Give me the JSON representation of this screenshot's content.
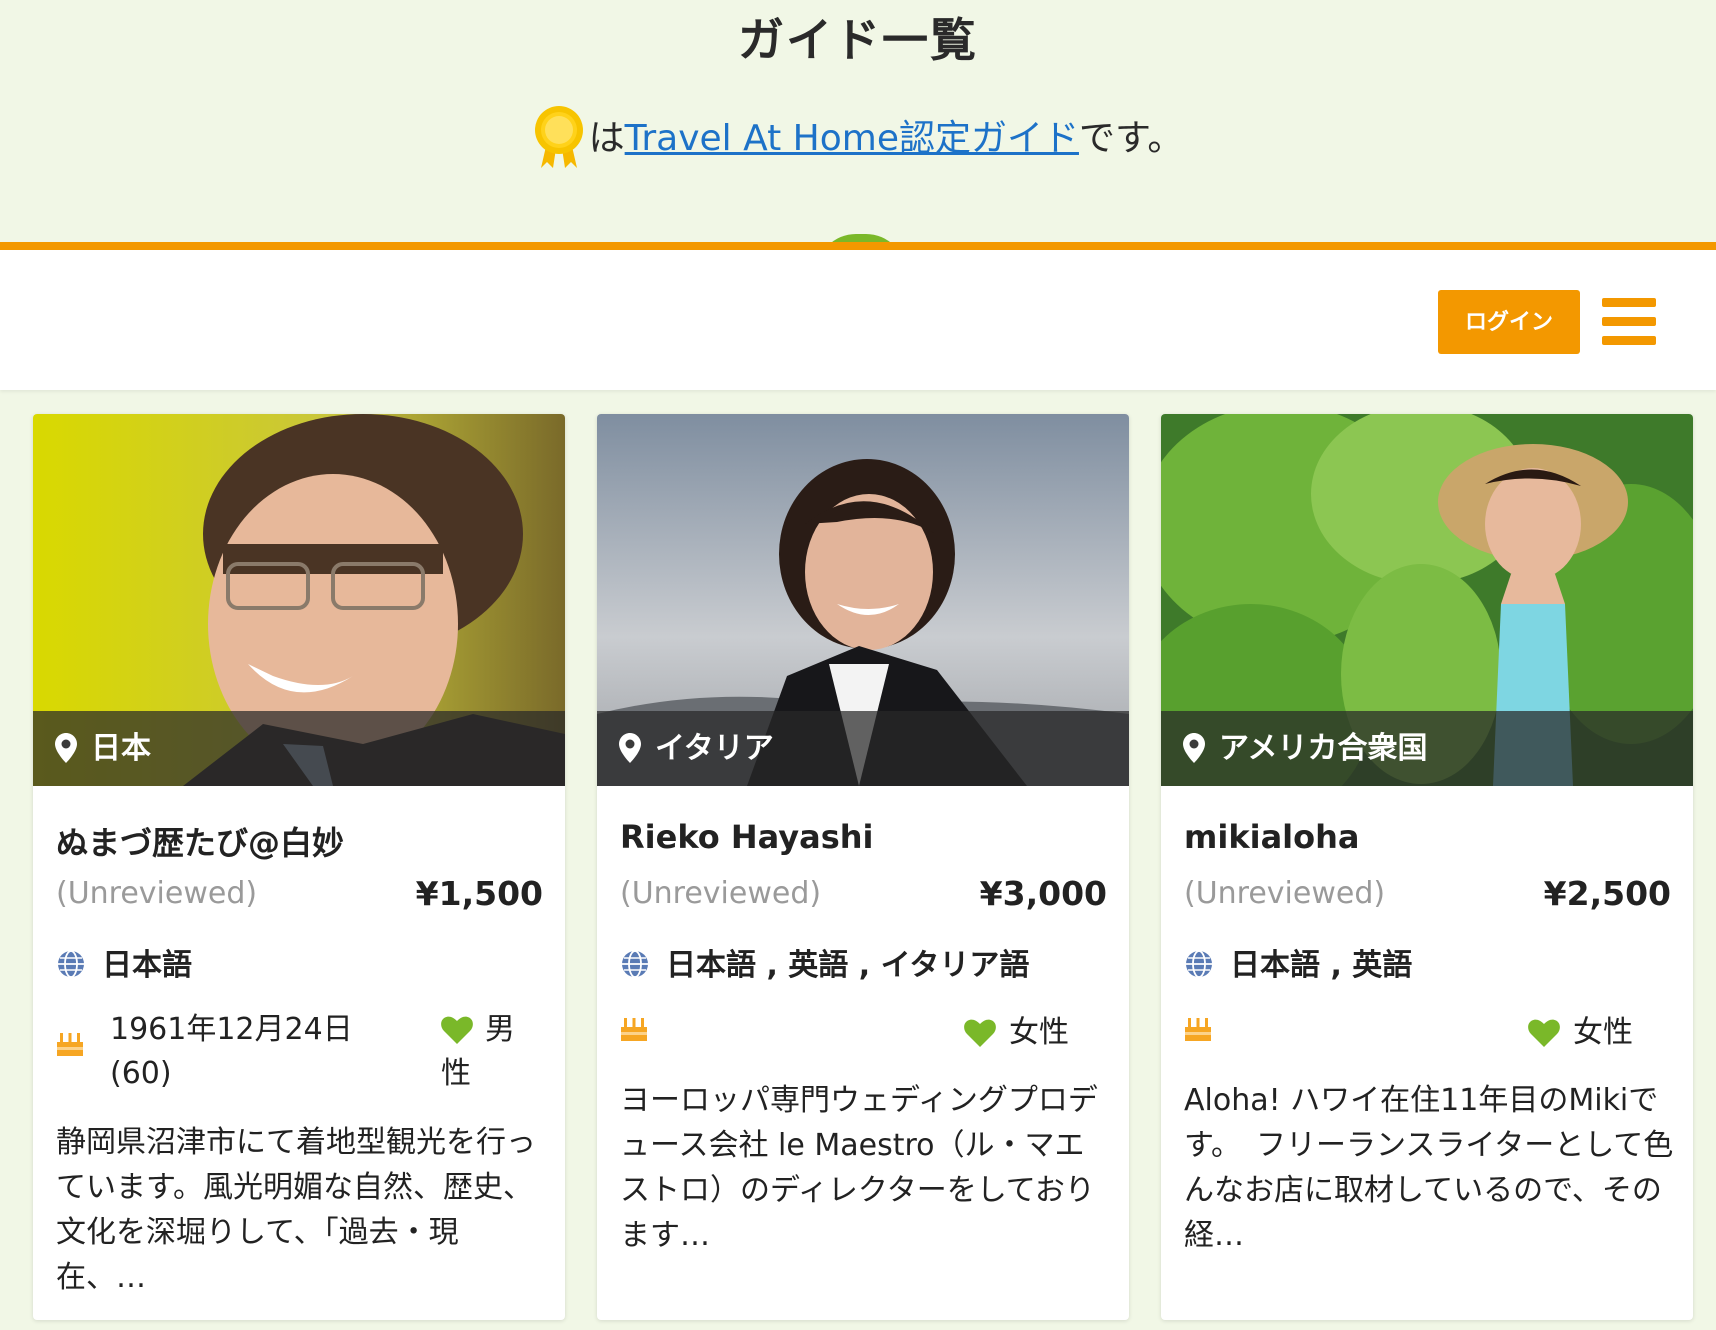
{
  "header": {
    "title": "ガイド一覧",
    "cert_prefix": "は",
    "cert_link": "Travel At Home認定ガイド",
    "cert_suffix": "です。"
  },
  "nav": {
    "login_label": "ログイン"
  },
  "icons": {
    "medal": "medal-icon",
    "location": "map-pin-icon",
    "language": "globe-icon",
    "birthday": "cake-icon",
    "gender": "heart-icon",
    "menu": "hamburger-menu-icon"
  },
  "colors": {
    "accent": "#f39800",
    "link": "#1d72c8",
    "heart": "#7ab829",
    "background": "#f1f7e6"
  },
  "guides": [
    {
      "country": "日本",
      "name": "ぬまづ歴たび@白妙",
      "review": "(Unreviewed)",
      "price": "¥1,500",
      "languages": "日本語",
      "birth_line1": "1961年12月24日",
      "birth_line2": "(60)",
      "gender_line1": "男",
      "gender_line2": "性",
      "description": "静岡県沼津市にて着地型観光を行っています。風光明媚な自然、歴史、文化を深堀りして、「過去・現在、…"
    },
    {
      "country": "イタリア",
      "name": "Rieko Hayashi",
      "review": "(Unreviewed)",
      "price": "¥3,000",
      "languages": "日本語 , 英語 , イタリア語",
      "gender": "女性",
      "description": "ヨーロッパ専門ウェディングプロデュース会社 le Maestro（ル・マエストロ）のディレクターをしております…"
    },
    {
      "country": "アメリカ合衆国",
      "name": "mikialoha",
      "review": "(Unreviewed)",
      "price": "¥2,500",
      "languages": "日本語 , 英語",
      "gender": "女性",
      "description": "Aloha! ハワイ在住11年目のMikiです。　フリーランスライターとして色んなお店に取材しているので、その経…"
    }
  ]
}
